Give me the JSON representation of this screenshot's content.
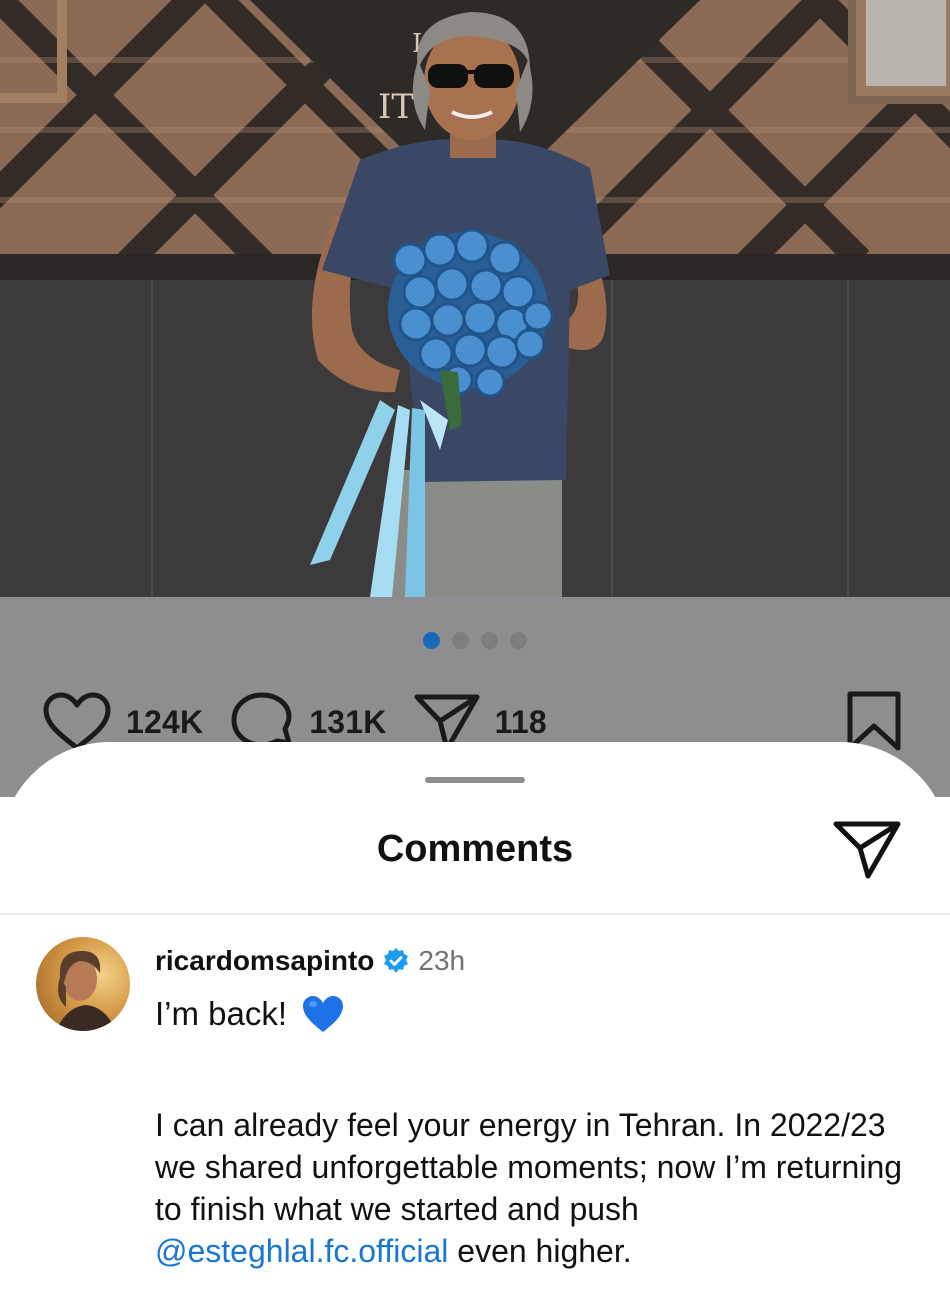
{
  "post": {
    "carousel": {
      "count": 4,
      "active_index": 0
    },
    "likes": "124K",
    "comments": "131K",
    "shares": "118",
    "wall_sign_text": "IT"
  },
  "comments_sheet": {
    "title": "Comments"
  },
  "comment": {
    "username": "ricardomsapinto",
    "verified": true,
    "time": "23h",
    "text_line1": "I’m back!",
    "body_before_mention": "I can already feel your energy in Tehran. In 2022/23 we shared unforgettable moments; now I’m returning to finish what we started and push ",
    "mention": "@esteghlal.fc.official",
    "body_after_mention": " even higher."
  },
  "colors": {
    "accent": "#1769b8",
    "mention": "#1877d4",
    "verified": "#1d9bf0",
    "heart_emoji": "#1e72e8"
  },
  "icons": [
    "heart-icon",
    "comment-icon",
    "share-icon",
    "bookmark-icon",
    "send-icon",
    "verified-badge-icon",
    "blue-heart-emoji"
  ]
}
